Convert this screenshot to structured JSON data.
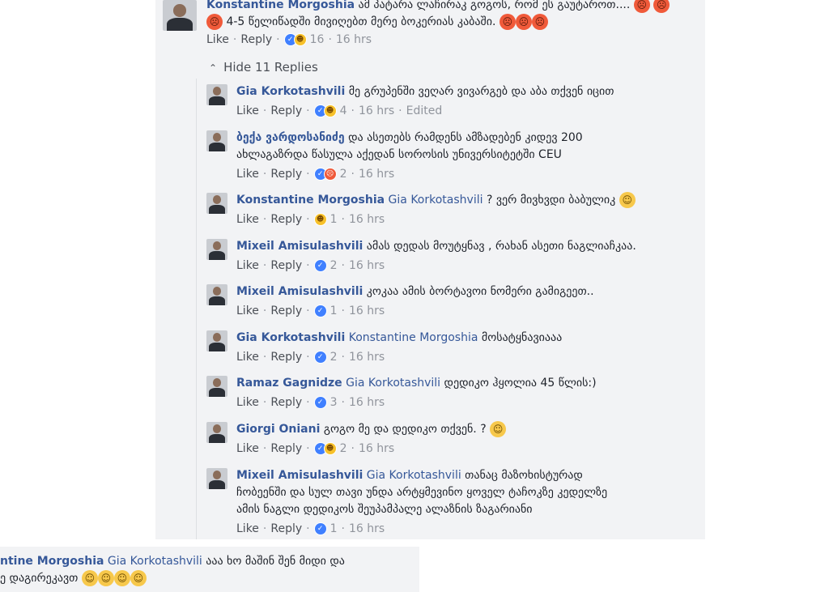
{
  "top_comment": {
    "name": "Konstantine Morgoshia",
    "line1": "ამ პატარა ლაჩირაკ გოგოს, რომ ეს გაუტაროთ.... ",
    "line2": "4-5 წელიწადში მივიღებთ მერე ბოკერიას კაბაში.",
    "like": "Like",
    "reply": "Reply",
    "count": "16",
    "time": "16 hrs"
  },
  "toggle": "Hide 11 Replies",
  "replies": [
    {
      "name": "Gia Korkotashvili",
      "tag": "",
      "lines": [
        "მე გრუპენში ვეღარ ვივარგებ და აბა თქვენ იცით"
      ],
      "count": "4",
      "time": "16 hrs",
      "edited": "Edited",
      "reactions": [
        "like",
        "haha"
      ],
      "emoji": ""
    },
    {
      "name": "ბექა ვარდოსანიძე",
      "tag": "",
      "lines": [
        "და ასეთებს რამდენს ამზადებენ კიდევ 200",
        "ახლაგაზრდა წასულა აქედან სოროსის უნივერსიტეტში CEU"
      ],
      "count": "2",
      "time": "16 hrs",
      "edited": "",
      "reactions": [
        "like",
        "angry"
      ],
      "emoji": ""
    },
    {
      "name": "Konstantine Morgoshia",
      "tag": "Gia Korkotashvili",
      "lines": [
        "? ვერ მივხვდი ბაბულიკ"
      ],
      "count": "1",
      "time": "16 hrs",
      "edited": "",
      "reactions": [
        "haha"
      ],
      "emoji": "smile"
    },
    {
      "name": "Mixeil Amisulashvili",
      "tag": "",
      "lines": [
        "ამას დედას მოუტყნავ , რახან ასეთი ნაგლიაჩკაა."
      ],
      "count": "2",
      "time": "16 hrs",
      "edited": "",
      "reactions": [
        "like"
      ],
      "emoji": ""
    },
    {
      "name": "Mixeil Amisulashvili",
      "tag": "",
      "lines": [
        "კოკაა ამის ბორტავოი ნომერი გამიგეეთ.."
      ],
      "count": "1",
      "time": "16 hrs",
      "edited": "",
      "reactions": [
        "like"
      ],
      "emoji": ""
    },
    {
      "name": "Gia Korkotashvili",
      "tag": "Konstantine Morgoshia",
      "lines": [
        "მოსატყნავიააა"
      ],
      "count": "2",
      "time": "16 hrs",
      "edited": "",
      "reactions": [
        "like"
      ],
      "emoji": ""
    },
    {
      "name": "Ramaz Gagnidze",
      "tag": "Gia Korkotashvili",
      "lines": [
        "დედიკო ჰყოლია 45 წლის:)"
      ],
      "count": "3",
      "time": "16 hrs",
      "edited": "",
      "reactions": [
        "like"
      ],
      "emoji": ""
    },
    {
      "name": "Giorgi Oniani",
      "tag": "",
      "lines": [
        "გოგო მე და დედიკო თქვენ. ?"
      ],
      "count": "2",
      "time": "16 hrs",
      "edited": "",
      "reactions": [
        "like",
        "haha"
      ],
      "emoji": "smile"
    },
    {
      "name": "Mixeil Amisulashvili",
      "tag": "Gia Korkotashvili",
      "lines": [
        "თანაც მაზოხისტურად",
        "ჩობეენში და სულ თავი უნდა არტყმევინო ყოველ ტაჩოკზე კედელზე",
        "ამის ნაგლი დედიკოს შეუპამპალე ალაზნის ზაგარიანი"
      ],
      "count": "1",
      "time": "16 hrs",
      "edited": "",
      "reactions": [
        "like"
      ],
      "emoji": ""
    }
  ],
  "bottom_comment": {
    "name": "ntine Morgoshia",
    "tag": "Gia Korkotashvili",
    "line1": "ააა ხო მაშინ შენ მიდი და",
    "line2": "ე დაგირეკავთ"
  },
  "labels": {
    "like": "Like",
    "reply": "Reply"
  }
}
